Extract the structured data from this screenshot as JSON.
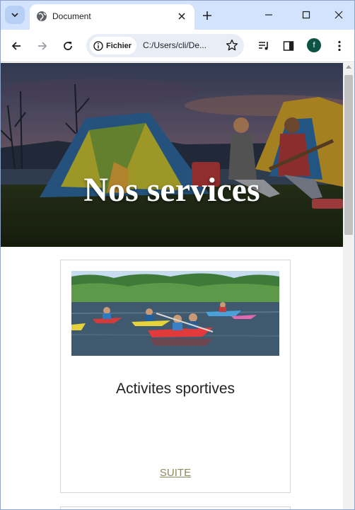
{
  "browser": {
    "tab_title": "Document",
    "security_chip": "Fichier",
    "url": "C:/Users/cli/De...",
    "profile_initial": "f"
  },
  "page": {
    "hero_title": "Nos services",
    "cards": [
      {
        "title": "Activites sportives",
        "link": "SUITE"
      }
    ]
  },
  "colors": {
    "tabstrip": "#d3e3fd",
    "link": "#8b8a5e",
    "avatar": "#0b5345"
  }
}
